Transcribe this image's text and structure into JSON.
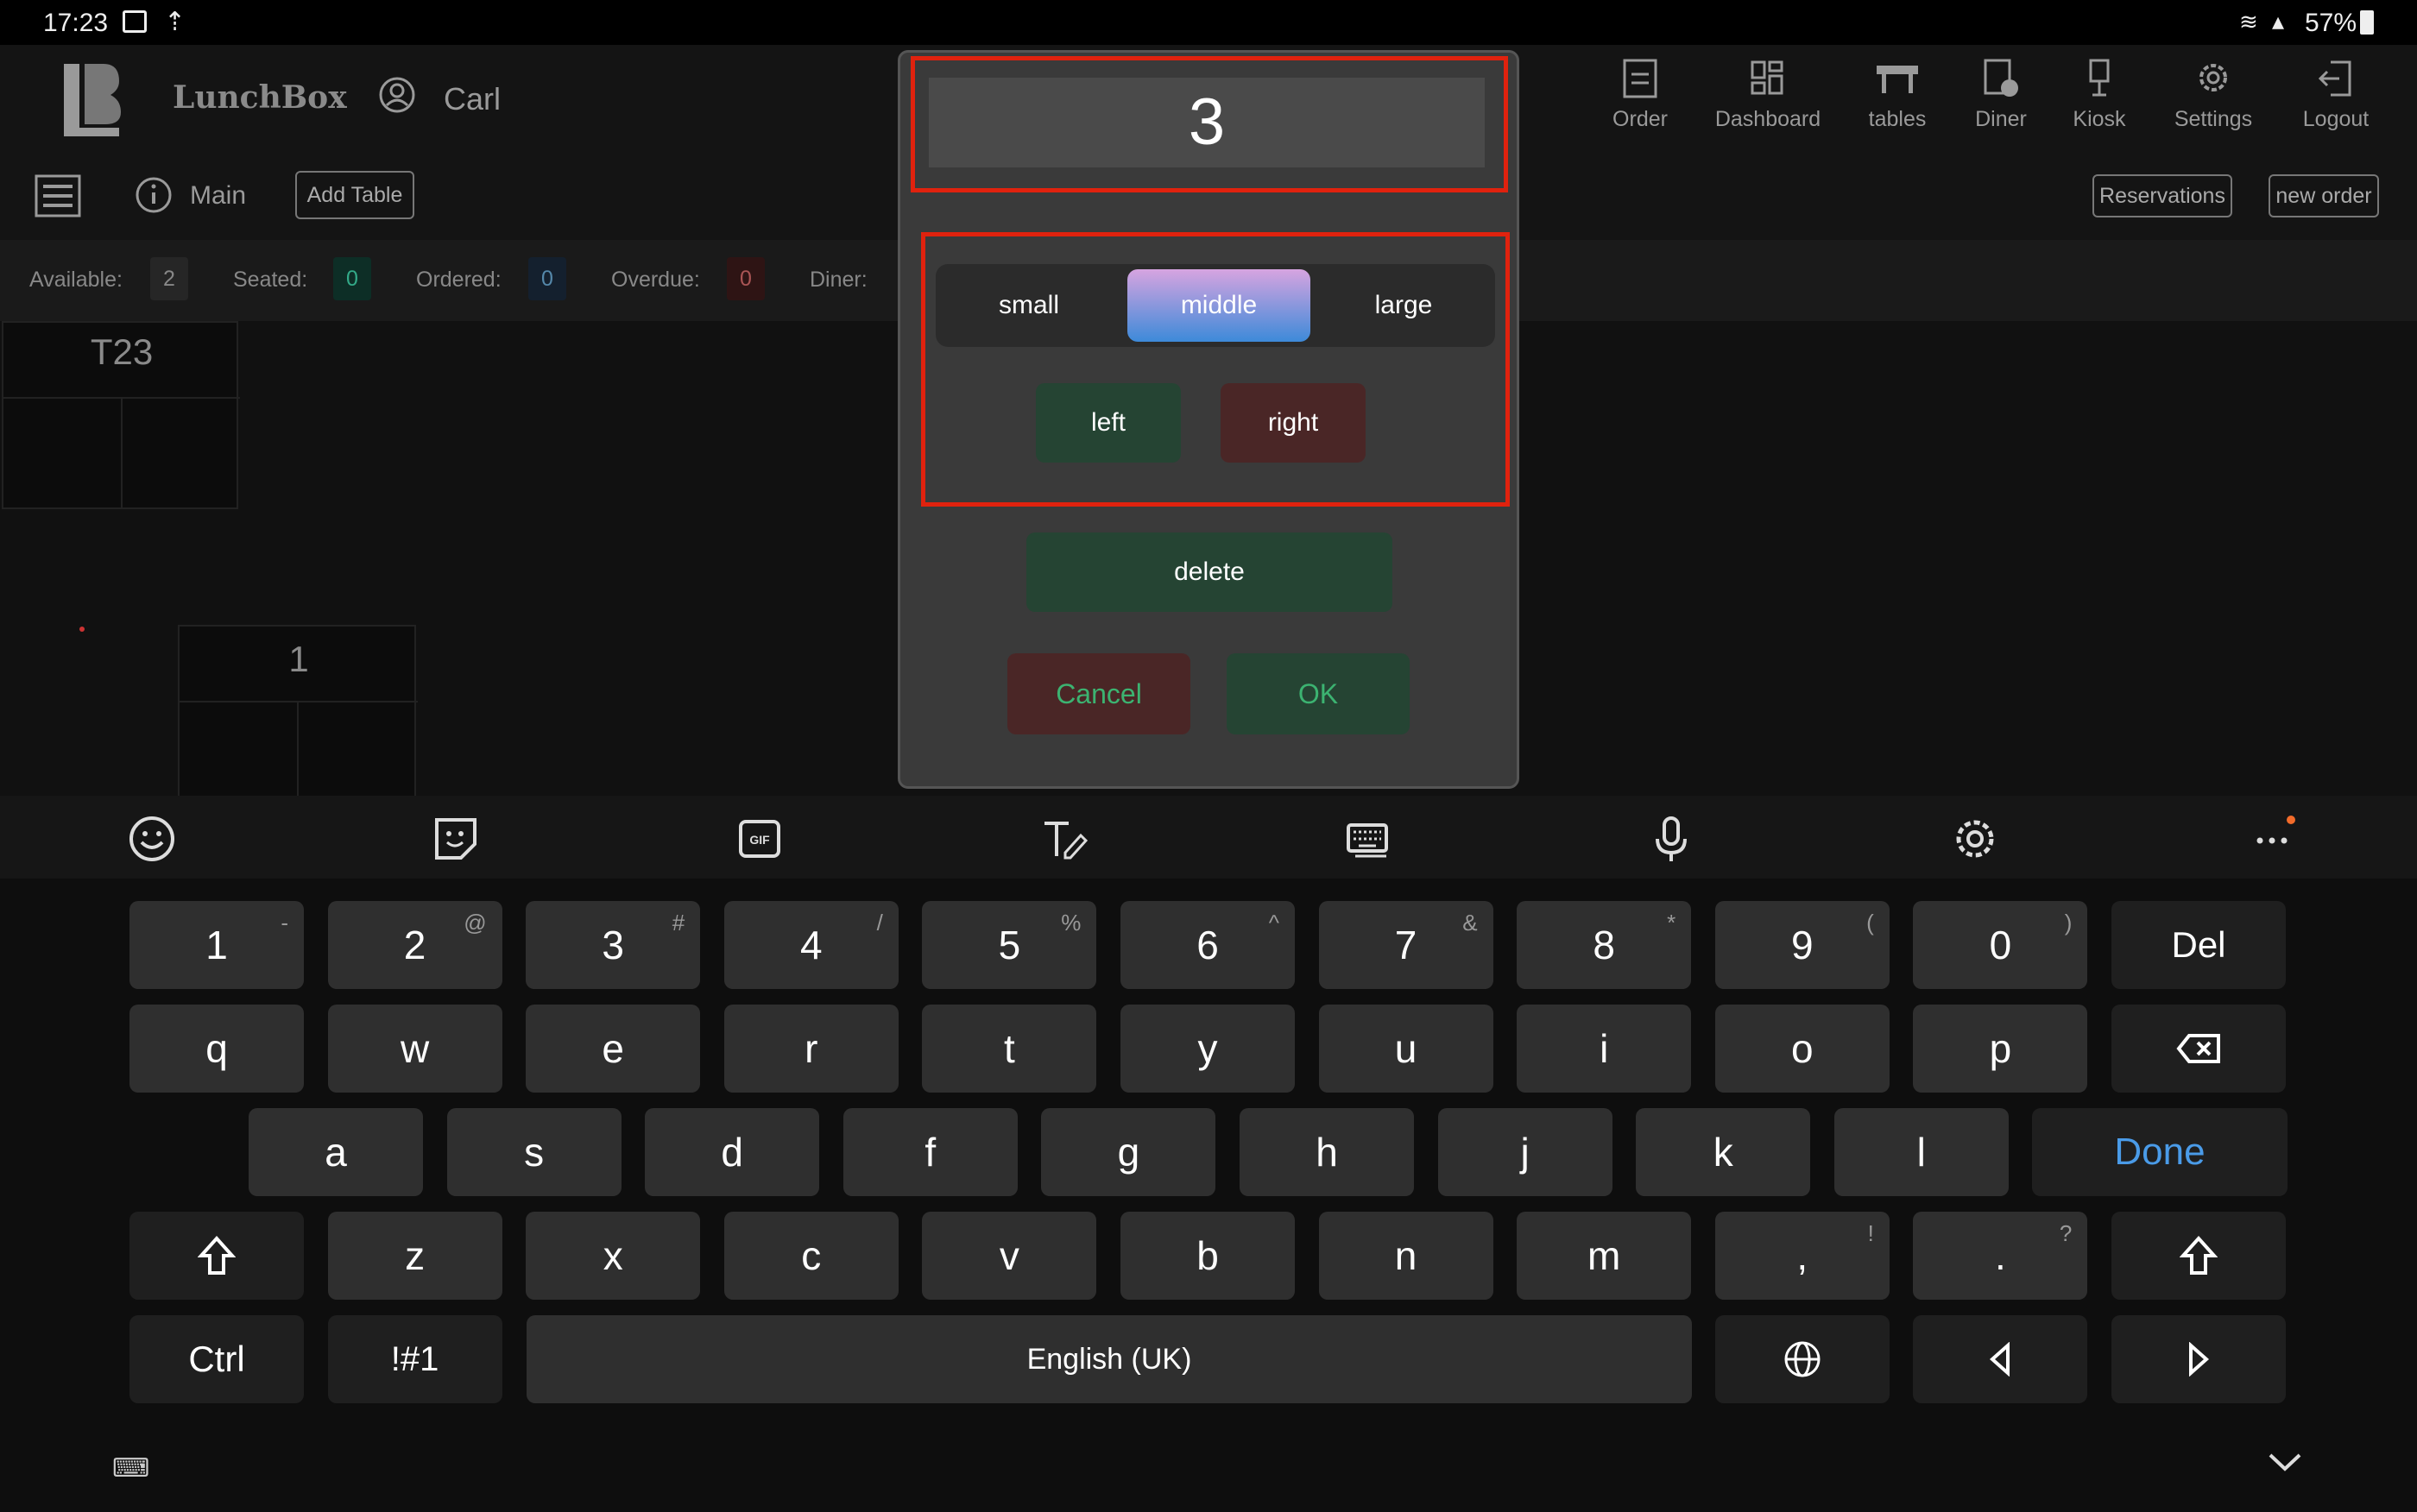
{
  "status_bar": {
    "time": "17:23",
    "battery": "57%"
  },
  "app": {
    "brand": "LunchBox",
    "user": "Carl",
    "nav": [
      {
        "label": "Order",
        "icon": "order-icon"
      },
      {
        "label": "Dashboard",
        "icon": "dashboard-icon"
      },
      {
        "label": "tables",
        "icon": "tables-icon"
      },
      {
        "label": "Diner",
        "icon": "diner-icon"
      },
      {
        "label": "Kiosk",
        "icon": "kiosk-icon"
      },
      {
        "label": "Settings",
        "icon": "gear-icon"
      },
      {
        "label": "Logout",
        "icon": "logout-icon"
      }
    ],
    "sub": {
      "section": "Main",
      "add_table": "Add Table",
      "reservations": "Reservations",
      "new_order": "new order"
    },
    "stats": [
      {
        "label": "Available:",
        "value": "2",
        "color": "#2a2a2a"
      },
      {
        "label": "Seated:",
        "value": "0",
        "color": "#0d3a2e"
      },
      {
        "label": "Ordered:",
        "value": "0",
        "color": "#14233a"
      },
      {
        "label": "Overdue:",
        "value": "0",
        "color": "#3a1414"
      },
      {
        "label": "Diner:",
        "value": "",
        "color": "#2a2a2a"
      }
    ],
    "tables": [
      {
        "name": "T23"
      },
      {
        "name": "1"
      }
    ]
  },
  "dialog": {
    "value": "3",
    "sizes": [
      "small",
      "middle",
      "large"
    ],
    "selected_size": "middle",
    "align": [
      "left",
      "right"
    ],
    "delete": "delete",
    "cancel": "Cancel",
    "ok": "OK",
    "colors": {
      "highlight": "#e0220e",
      "green_btn": "#254433",
      "red_btn": "#4a2626",
      "ok_text": "#3cb371",
      "cancel_text": "#3cb371"
    }
  },
  "keyboard": {
    "row1": [
      {
        "k": "1",
        "s": "-"
      },
      {
        "k": "2",
        "s": "@"
      },
      {
        "k": "3",
        "s": "#"
      },
      {
        "k": "4",
        "s": "/"
      },
      {
        "k": "5",
        "s": "%"
      },
      {
        "k": "6",
        "s": "^"
      },
      {
        "k": "7",
        "s": "&"
      },
      {
        "k": "8",
        "s": "*"
      },
      {
        "k": "9",
        "s": "("
      },
      {
        "k": "0",
        "s": ")"
      },
      {
        "k": "Del",
        "s": ""
      }
    ],
    "row2": [
      "q",
      "w",
      "e",
      "r",
      "t",
      "y",
      "u",
      "i",
      "o",
      "p"
    ],
    "row3": [
      "a",
      "s",
      "d",
      "f",
      "g",
      "h",
      "j",
      "k",
      "l"
    ],
    "done": "Done",
    "row4": [
      "z",
      "x",
      "c",
      "v",
      "b",
      "n",
      "m"
    ],
    "comma": {
      "k": ",",
      "s": "!"
    },
    "period": {
      "k": ".",
      "s": "?"
    },
    "ctrl": "Ctrl",
    "symbols": "!#1",
    "space": "English (UK)"
  }
}
